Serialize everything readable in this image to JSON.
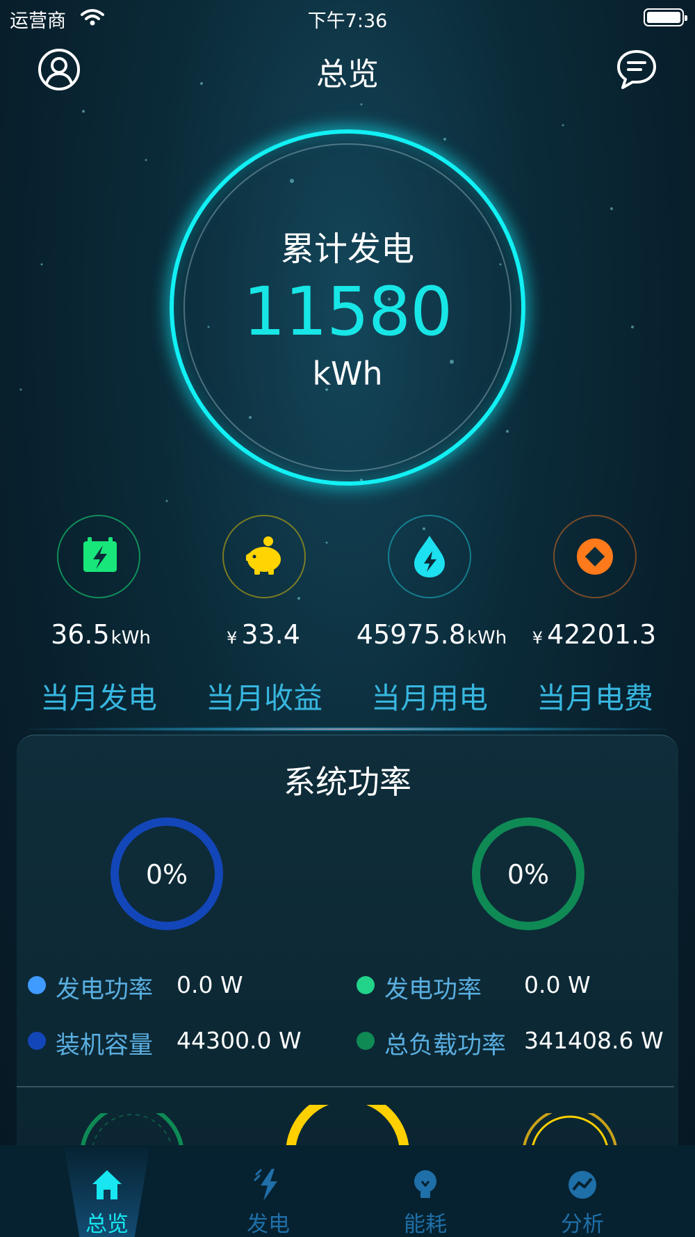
{
  "status_bar": {
    "carrier": "运营商",
    "time": "下午7:36"
  },
  "nav": {
    "title": "总览",
    "left_icon": "user-icon",
    "right_icon": "message-icon"
  },
  "summary": {
    "label": "累计发电",
    "value": "11580",
    "unit": "kWh"
  },
  "stats": [
    {
      "prefix": "",
      "value": "36.5",
      "unit": "kWh",
      "label": "当月发电",
      "icon": "battery-calendar-icon",
      "color": "#18e67a"
    },
    {
      "prefix": "¥",
      "value": "33.4",
      "unit": "",
      "label": "当月收益",
      "icon": "piggy-bank-icon",
      "color": "#ffd400"
    },
    {
      "prefix": "",
      "value": "45975.8",
      "unit": "kWh",
      "label": "当月用电",
      "icon": "energy-drop-icon",
      "color": "#1de0f0"
    },
    {
      "prefix": "¥",
      "value": "42201.3",
      "unit": "",
      "label": "当月电费",
      "icon": "coin-icon",
      "color": "#ff7a1a"
    }
  ],
  "power": {
    "title": "系统功率",
    "left_gauge": {
      "percent": "0%",
      "color": "#1346b8"
    },
    "right_gauge": {
      "percent": "0%",
      "color": "#0f8a55"
    },
    "left_legend": [
      {
        "label": "发电功率",
        "value": "0.0 W",
        "color": "#3f9bff"
      },
      {
        "label": "装机容量",
        "value": "44300.0 W",
        "color": "#1346b8"
      }
    ],
    "right_legend": [
      {
        "label": "发电功率",
        "value": "0.0 W",
        "color": "#22d38a"
      },
      {
        "label": "总负载功率",
        "value": "341408.6 W",
        "color": "#0f8a55"
      }
    ]
  },
  "tabs": [
    {
      "label": "总览",
      "icon": "home-icon",
      "active": true
    },
    {
      "label": "发电",
      "icon": "lightning-icon",
      "active": false
    },
    {
      "label": "能耗",
      "icon": "bulb-icon",
      "active": false
    },
    {
      "label": "分析",
      "icon": "analysis-icon",
      "active": false
    }
  ],
  "colors": {
    "accent": "#12f0f4",
    "label_blue": "#37b6df",
    "background": "#0b2b39"
  }
}
